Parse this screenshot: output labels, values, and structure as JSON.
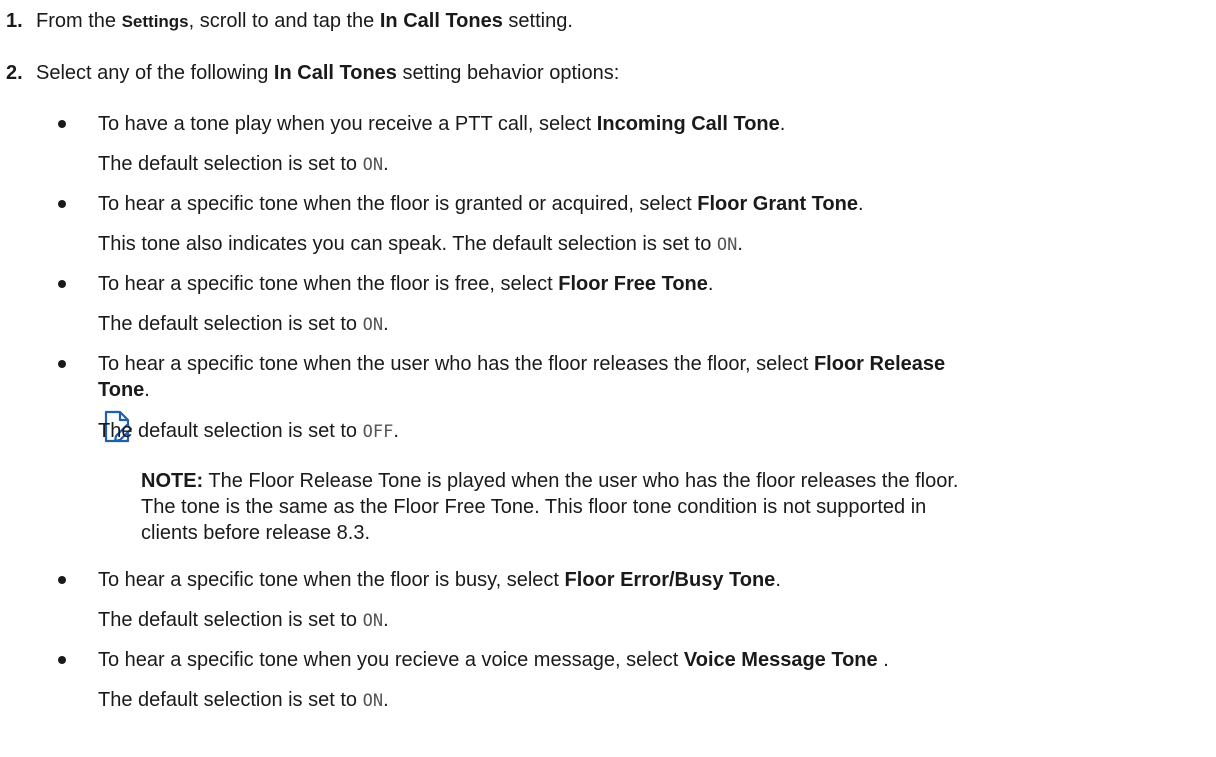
{
  "steps": [
    {
      "number": "1.",
      "prefix": "From the ",
      "settings": "Settings",
      "middle": ", scroll to and tap the ",
      "target": "In Call Tones",
      "suffix": " setting."
    },
    {
      "number": "2.",
      "prefix": "Select any of the following ",
      "target": "In Call Tones",
      "suffix": " setting behavior options:"
    }
  ],
  "options": [
    {
      "text": "To have a tone play when you receive a PTT call, select ",
      "name": "Incoming Call Tone",
      "end": ".",
      "default_prefix": "The default selection is set to ",
      "default_value": "ON",
      "default_end": "."
    },
    {
      "text": "To hear a specific tone when the floor is granted or acquired, select ",
      "name": "Floor Grant Tone",
      "end": ".",
      "default_prefix": "This tone also indicates you can speak. The default selection is set to ",
      "default_value": "ON",
      "default_end": "."
    },
    {
      "text": "To hear a specific tone when the floor is free, select ",
      "name": "Floor Free Tone",
      "end": ".",
      "default_prefix": "The default selection is set to ",
      "default_value": "ON",
      "default_end": "."
    },
    {
      "text": "To hear a specific tone when the user who has the floor releases the floor, select ",
      "name": "Floor Release",
      "name_cont": "Tone",
      "end": ".",
      "default_prefix": "The default selection is set to ",
      "default_value": "OFF",
      "default_end": "."
    },
    {
      "text": "To hear a specific tone when the floor is busy, select ",
      "name": "Floor Error/Busy Tone",
      "end": ".",
      "default_prefix": "The default selection is set to ",
      "default_value": "ON",
      "default_end": "."
    },
    {
      "text": "To hear a specific tone when you recieve a voice message, select ",
      "name": "Voice Message Tone",
      "end": " .",
      "default_prefix": "The default selection is set to ",
      "default_value": "ON",
      "default_end": "."
    }
  ],
  "note": {
    "icon": "note-pencil-icon",
    "label": "NOTE:",
    "line1": " The Floor Release Tone is played when the user who has the floor releases the floor.",
    "line2": "The tone is the same as the Floor Free Tone. This floor tone condition is not supported in",
    "line3": "clients before release 8.3."
  },
  "colors": {
    "text": "#1a1a1a",
    "icon": "#1f5fae",
    "mono": "#555555"
  }
}
